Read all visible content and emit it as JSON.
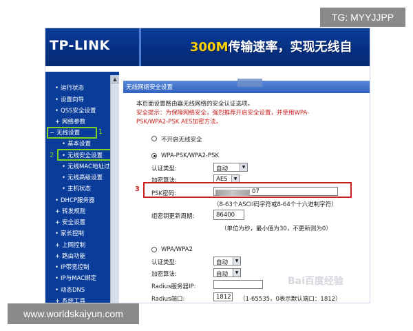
{
  "overlay": {
    "tg": "TG: MYYJJPP",
    "url": "www.worldskaiyun.com"
  },
  "header": {
    "logo": "TP-LINK",
    "banner_prefix": "300M",
    "banner_text": "传输速率，实现无线自"
  },
  "sidebar": {
    "items": [
      {
        "bullet": "•",
        "label": "运行状态"
      },
      {
        "bullet": "•",
        "label": "设置向导"
      },
      {
        "bullet": "•",
        "label": "QSS安全设置"
      },
      {
        "bullet": "+",
        "label": "网络参数"
      },
      {
        "bullet": "−",
        "label": "无线设置"
      },
      {
        "bullet": "•",
        "label": "基本设置"
      },
      {
        "bullet": "•",
        "label": "无线安全设置"
      },
      {
        "bullet": "•",
        "label": "无线MAC地址过滤"
      },
      {
        "bullet": "•",
        "label": "无线高级设置"
      },
      {
        "bullet": "•",
        "label": "主机状态"
      },
      {
        "bullet": "•",
        "label": "DHCP服务器"
      },
      {
        "bullet": "+",
        "label": "转发规则"
      },
      {
        "bullet": "+",
        "label": "安全设置"
      },
      {
        "bullet": "•",
        "label": "家长控制"
      },
      {
        "bullet": "+",
        "label": "上网控制"
      },
      {
        "bullet": "+",
        "label": "路由功能"
      },
      {
        "bullet": "•",
        "label": "IP带宽控制"
      },
      {
        "bullet": "•",
        "label": "IP与MAC绑定"
      },
      {
        "bullet": "•",
        "label": "动态DNS"
      },
      {
        "bullet": "+",
        "label": "系统工具"
      }
    ],
    "annotation_1": "1",
    "annotation_2": "2"
  },
  "main": {
    "title": "无线网络安全设置",
    "intro": "本页面设置路由器无线网络的安全认证选项。",
    "warning_line1": "安全提示：为保障网络安全，强烈推荐开启安全设置，并使用WPA-",
    "warning_line2": "PSK/WPA2-PSK AES加密方法。",
    "option_off": "不开启无线安全",
    "option_wpa_psk": "WPA-PSK/WPA2-PSK",
    "auth_label": "认证类型:",
    "auth_value": "自动",
    "enc_label": "加密算法:",
    "enc_value": "AES",
    "psk_label": "PSK密码:",
    "psk_value_tail": "07",
    "psk_hint": "（8-63个ASCII码字符或8-64个十六进制字符）",
    "renew_label": "组密钥更新周期:",
    "renew_value": "86400",
    "renew_hint": "（单位为秒，最小值为30，不更新则为0）",
    "option_wpa": "WPA/WPA2",
    "auth2_label": "认证类型:",
    "auth2_value": "自动",
    "enc2_label": "加密算法:",
    "enc2_value": "自动",
    "radius_ip_label": "Radius服务器IP:",
    "radius_port_label": "Radius端口:",
    "radius_port_value": "1812",
    "radius_port_hint": "（1-65535，0表示默认端口：1812）",
    "annotation_3": "3",
    "watermark": "Bai百度经验"
  },
  "colors": {
    "header": "#0a3d9a",
    "highlight_green": "#7ed321",
    "highlight_red": "#c8201e",
    "banner_accent": "#ffd200"
  }
}
